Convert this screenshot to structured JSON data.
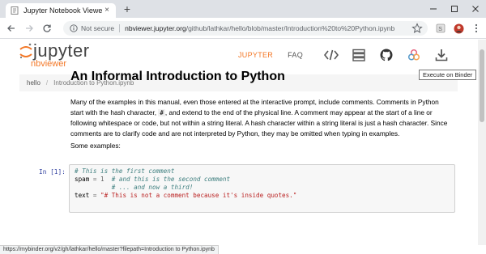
{
  "browser": {
    "tab_title": "Jupyter Notebook Viewer",
    "tab_close": "×",
    "new_tab": "+",
    "security_label": "Not secure",
    "url_host": "nbviewer.jupyter.org",
    "url_path": "/github/lathkar/hello/blob/master/Introduction%20to%20Python.ipynb"
  },
  "site": {
    "logo_text": "jupyter",
    "logo_sub": "nbviewer",
    "nav_jupyter": "JUPYTER",
    "nav_faq": "FAQ",
    "tooltip": "Execute on Binder"
  },
  "breadcrumb": {
    "home": "hello",
    "current": "Introduction to Python.ipynb"
  },
  "notebook": {
    "title": "An Informal Introduction to Python",
    "para1_a": "Many of the examples in this manual, even those entered at the interactive prompt, include comments. Comments in Python start with the hash character, ",
    "para1_code": "#",
    "para1_b": ", and extend to the end of the physical line. A comment may appear at the start of a line or following whitespace or code, but not within a string literal. A hash character within a string literal is just a hash character. Since comments are to clarify code and are not interpreted by Python, they may be omitted when typing in examples.",
    "para2": "Some examples:",
    "cell_prompt": "In [1]:",
    "code_line1": "# This is the first comment",
    "code_line2_name": "spam",
    "code_line2_op": " = ",
    "code_line2_num": "1",
    "code_line2_comment": "  # and this is the second comment",
    "code_line3": "          # ... and now a third!",
    "code_line4_name": "text",
    "code_line4_op": " = ",
    "code_line4_str": "\"# This is not a comment because it's inside quotes.\""
  },
  "status": {
    "link_preview": "https://mybinder.org/v2/gh/lathkar/hello/master?filepath=Introduction to Python.ipynb"
  },
  "colors": {
    "accent": "#f37726",
    "chrome": "#dee1e6"
  }
}
